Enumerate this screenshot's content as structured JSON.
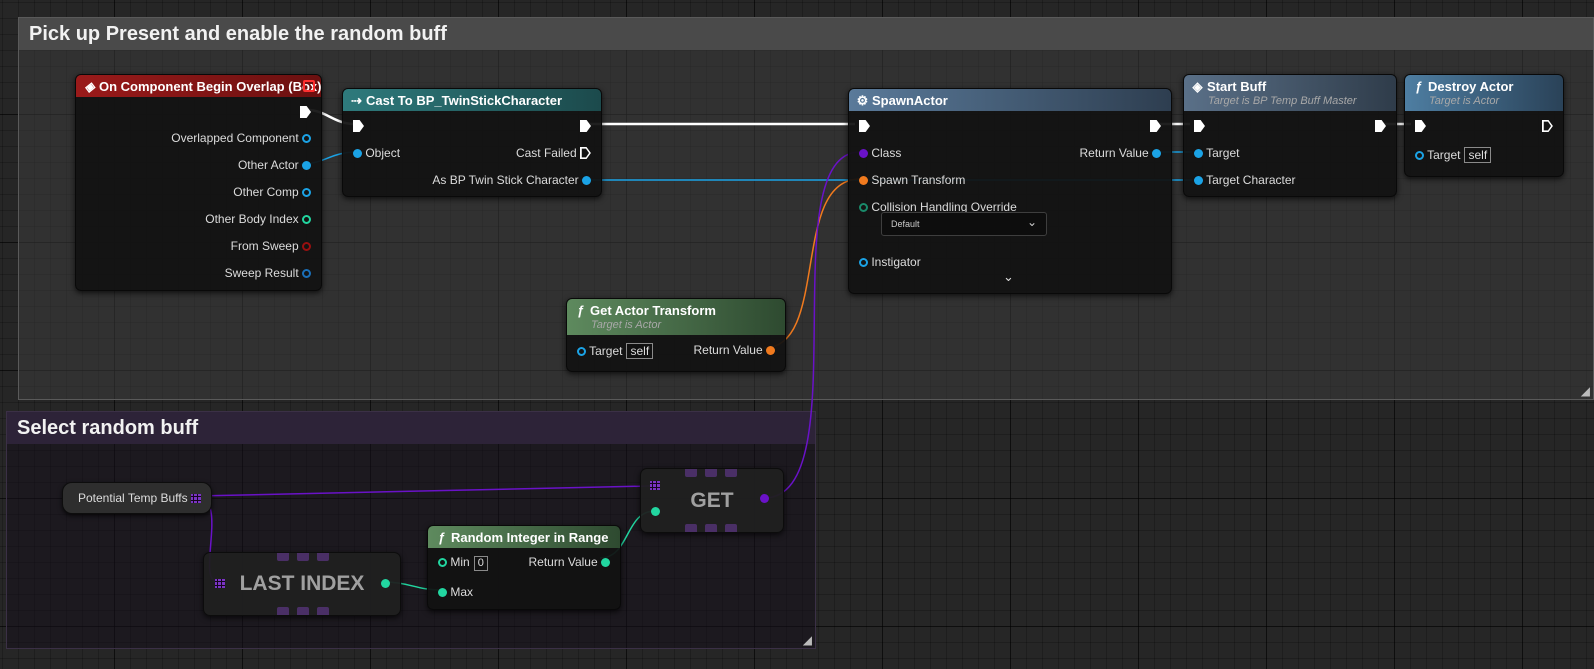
{
  "comments": {
    "pickup": {
      "title": "Pick up Present and enable the random buff"
    },
    "select": {
      "title": "Select random buff"
    }
  },
  "nodes": {
    "overlap": {
      "title": "On Component Begin Overlap (Box)",
      "pins": [
        "Overlapped Component",
        "Other Actor",
        "Other Comp",
        "Other Body Index",
        "From Sweep",
        "Sweep Result"
      ]
    },
    "cast": {
      "title": "Cast To BP_TwinStickCharacter",
      "object": "Object",
      "cast_failed": "Cast Failed",
      "as_char": "As BP Twin Stick Character"
    },
    "spawn": {
      "title": "SpawnActor",
      "class": "Class",
      "spawn_transform": "Spawn Transform",
      "collision": "Collision Handling Override",
      "collision_value": "Default",
      "instigator": "Instigator",
      "return_value": "Return Value"
    },
    "startbuff": {
      "title": "Start Buff",
      "subtitle": "Target is BP Temp Buff Master",
      "target": "Target",
      "target_character": "Target Character"
    },
    "destroy": {
      "title": "Destroy Actor",
      "subtitle": "Target is Actor",
      "target": "Target",
      "self": "self"
    },
    "gettransform": {
      "title": "Get Actor Transform",
      "subtitle": "Target is Actor",
      "target": "Target",
      "self": "self",
      "return_value": "Return Value"
    },
    "potential": {
      "label": "Potential Temp Buffs"
    },
    "lastindex": {
      "label": "LAST INDEX"
    },
    "get": {
      "label": "GET"
    },
    "randint": {
      "title": "Random Integer in Range",
      "min": "Min",
      "min_value": "0",
      "max": "Max",
      "return_value": "Return Value"
    }
  },
  "colors": {
    "event_header": "#8a1414",
    "cast_header": "#2b6e70",
    "call_header": "#4a6a86",
    "pure_header": "#4e7a4e",
    "object_pin": "#1ba3e6",
    "struct_pin": "#f07a1e",
    "class_pin": "#6a12c8",
    "int_pin": "#22d6a0",
    "bool_pin": "#9a1010",
    "array_pin": "#7b34c4"
  }
}
